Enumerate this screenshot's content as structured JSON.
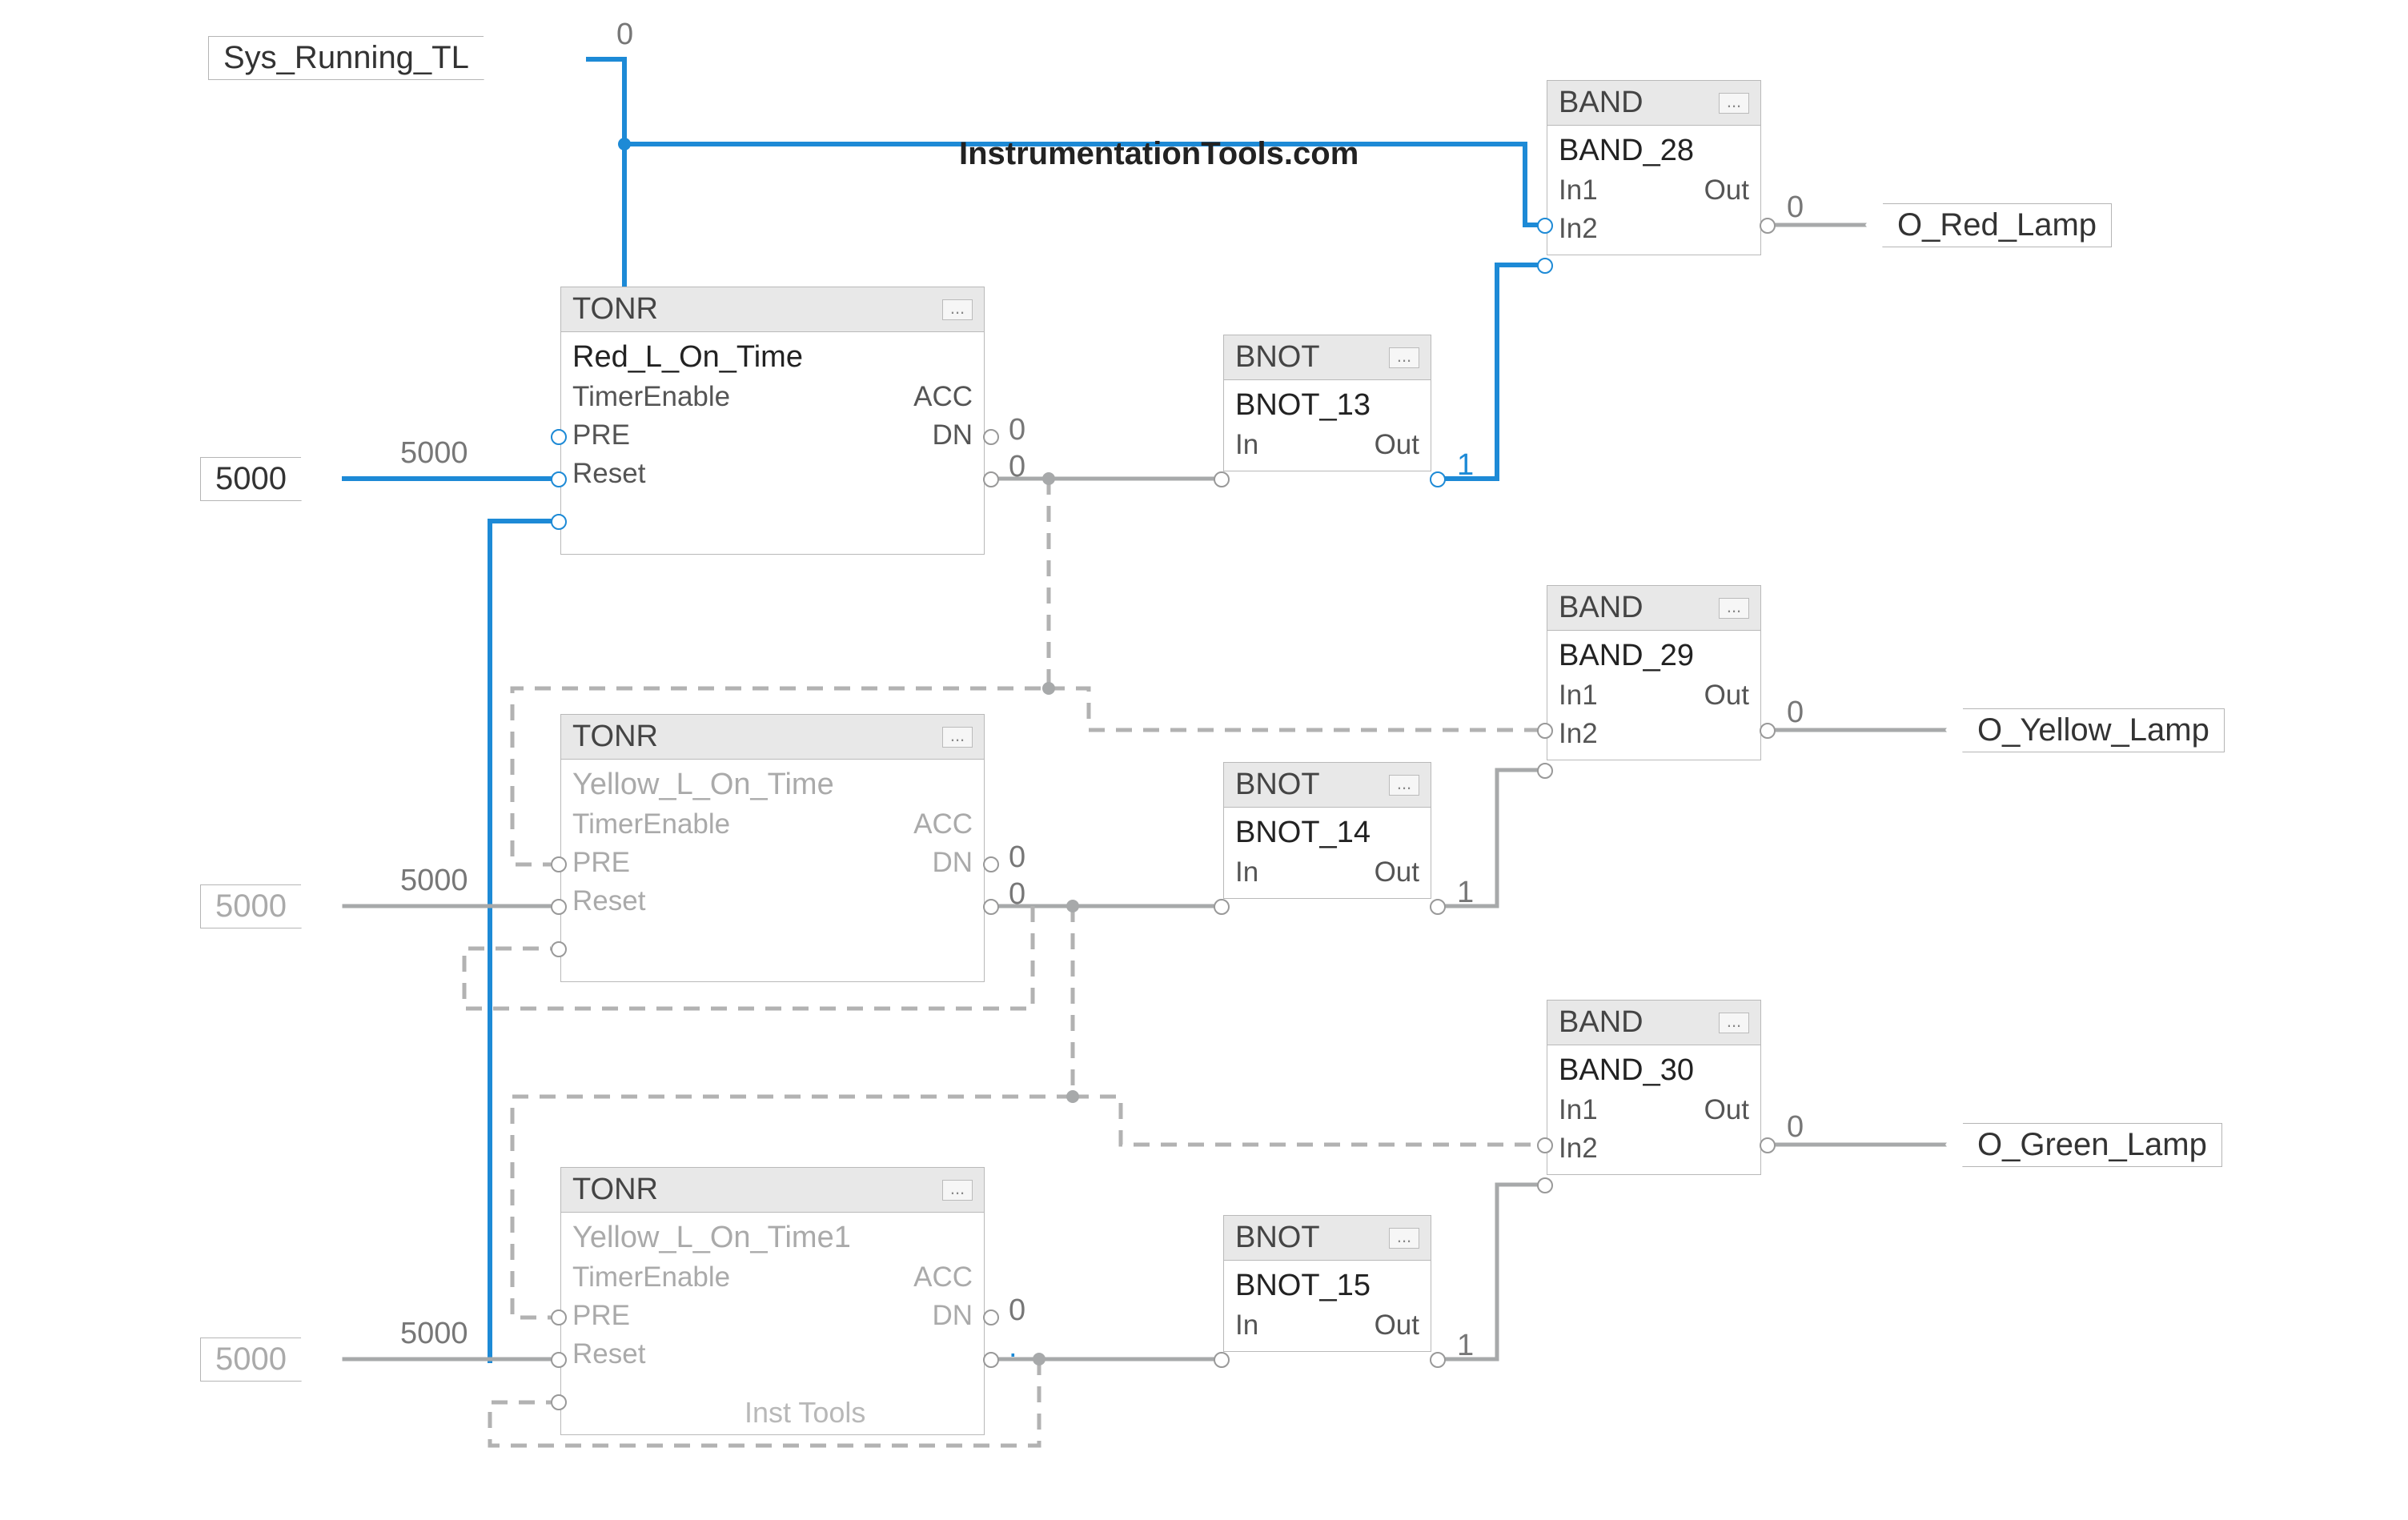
{
  "colors": {
    "blue": "#1d8ad6",
    "grey": "#a7a9aa",
    "greyDash": "#b2b2b2",
    "text": "#444"
  },
  "watermark_main": "InstrumentationTools.com",
  "watermark_small": "Inst Tools",
  "tags": {
    "sys_running": "Sys_Running_TL",
    "in5000_a": "5000",
    "in5000_b": "5000",
    "in5000_c": "5000",
    "out_red": "O_Red_Lamp",
    "out_yellow": "O_Yellow_Lamp",
    "out_green": "O_Green_Lamp"
  },
  "vals": {
    "sys_out": "0",
    "pre_a": "5000",
    "pre_b": "5000",
    "pre_c": "5000",
    "acc_a": "0",
    "dn_a": "0",
    "acc_b": "0",
    "dn_b": "0",
    "acc_c": "0",
    "dn_c": "0",
    "bnot13_out": "1",
    "bnot14_out": "1",
    "bnot15_out": "1",
    "band28_out": "0",
    "band29_out": "0",
    "band30_out": "0",
    "dot_c": "."
  },
  "blocks": {
    "tonr": {
      "type": "TONR",
      "pins_l": [
        "TimerEnable",
        "PRE",
        "Reset"
      ],
      "pins_r": [
        "ACC",
        "DN"
      ]
    },
    "tonr_a_name": "Red_L_On_Time",
    "tonr_b_name": "Yellow_L_On_Time",
    "tonr_c_name": "Yellow_L_On_Time1",
    "bnot": {
      "type": "BNOT",
      "pin_l": "In",
      "pin_r": "Out"
    },
    "bnot13": "BNOT_13",
    "bnot14": "BNOT_14",
    "bnot15": "BNOT_15",
    "band": {
      "type": "BAND",
      "pins_l": [
        "In1",
        "In2"
      ],
      "pin_r": "Out"
    },
    "band28": "BAND_28",
    "band29": "BAND_29",
    "band30": "BAND_30",
    "hdr_dots": "..."
  }
}
